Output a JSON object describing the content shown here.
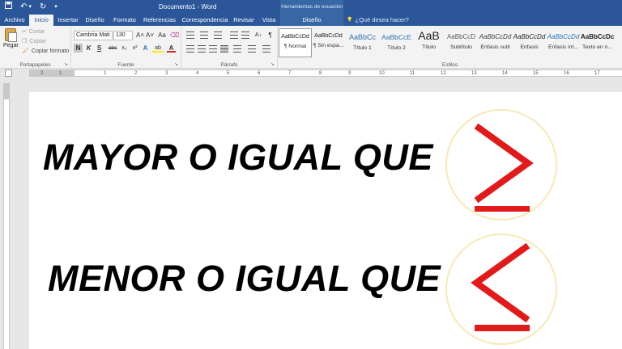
{
  "window": {
    "doc_title": "Documento1 - Word",
    "context_title": "Herramientas de ecuación"
  },
  "qat": {
    "save_icon": "save-icon",
    "undo_glyph": "↶",
    "redo_glyph": "↻",
    "dropdown_glyph": "▾"
  },
  "tabs": [
    {
      "label": "Archivo"
    },
    {
      "label": "Inicio"
    },
    {
      "label": "Insertar"
    },
    {
      "label": "Diseño"
    },
    {
      "label": "Formato"
    },
    {
      "label": "Referencias"
    },
    {
      "label": "Correspondencia"
    },
    {
      "label": "Revisar"
    },
    {
      "label": "Vista"
    },
    {
      "label": "Diseño"
    }
  ],
  "tell_me": {
    "icon": "💡",
    "text": "¿Qué desea hacer?"
  },
  "ribbon": {
    "clipboard": {
      "label": "Portapapeles",
      "paste": "Pegar",
      "cut": "Cortar",
      "copy": "Copiar",
      "format_painter": "Copiar formato"
    },
    "font": {
      "label": "Fuente",
      "family": "Cambria Mati",
      "size": "130",
      "grow": "A˄",
      "shrink": "A˅",
      "case": "Aa",
      "clear": "⌫",
      "bold": "N",
      "italic": "K",
      "underline": "S",
      "strike": "abc",
      "subscript": "x₂",
      "superscript": "x²",
      "effects": "A",
      "highlight": "ab",
      "color": "A"
    },
    "paragraph": {
      "label": "Párrafo",
      "show_marks": "¶",
      "sort": "A↓"
    },
    "styles": {
      "label": "Estilos",
      "items": [
        {
          "sample": "AaBbCcDd",
          "name": "¶ Normal"
        },
        {
          "sample": "AaBbCcDd",
          "name": "¶ Sin espa..."
        },
        {
          "sample": "AaBbCc",
          "name": "Título 1"
        },
        {
          "sample": "AaBbCcE",
          "name": "Título 2"
        },
        {
          "sample": "AaB",
          "name": "Título"
        },
        {
          "sample": "AaBbCcD",
          "name": "Subtítulo"
        },
        {
          "sample": "AaBbCcDd",
          "name": "Énfasis sutil"
        },
        {
          "sample": "AaBbCcDd",
          "name": "Énfasis"
        },
        {
          "sample": "AaBbCcDd",
          "name": "Énfasis int..."
        },
        {
          "sample": "AaBbCcDc",
          "name": "Texto en n..."
        }
      ]
    }
  },
  "ruler": {
    "numbers": [
      "2",
      "1",
      "1",
      "2",
      "3",
      "4",
      "5",
      "6",
      "7",
      "8",
      "9",
      "10",
      "11",
      "12",
      "13",
      "14",
      "15",
      "16",
      "17"
    ]
  },
  "document": {
    "line1": "MAYOR O IGUAL QUE",
    "line2": "MENOR O IGUAL QUE",
    "symbol_color": "#e21a1a",
    "circle_color": "#f6e9b4"
  }
}
